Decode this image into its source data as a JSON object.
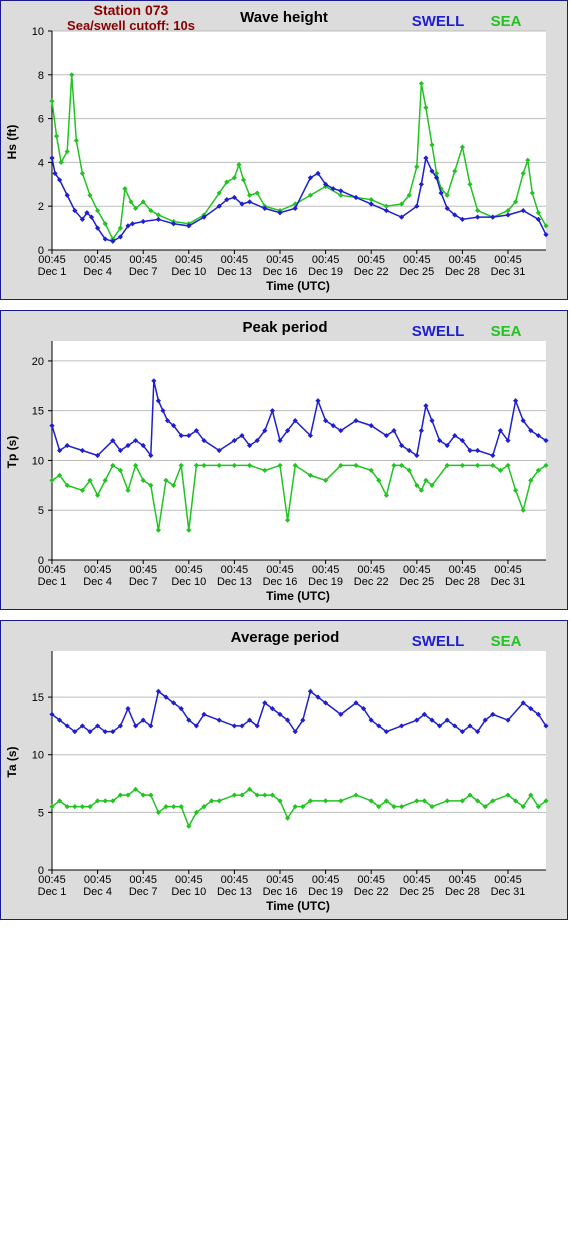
{
  "header": {
    "station": "Station 073",
    "cutoff": "Sea/swell cutoff: 10s"
  },
  "legend": {
    "swell": "SWELL",
    "sea": "SEA"
  },
  "colors": {
    "swell": "#1f1fd0",
    "sea": "#22c322",
    "panel_bg": "#dcdcdc",
    "border": "#1a1a8c",
    "header": "#8b0000"
  },
  "x_axis": {
    "label": "Time (UTC)",
    "tick_time": "00:45",
    "tick_dates": [
      "Dec 1",
      "Dec 4",
      "Dec 7",
      "Dec 10",
      "Dec 13",
      "Dec 16",
      "Dec 19",
      "Dec 22",
      "Dec 25",
      "Dec 28",
      "Dec 31"
    ]
  },
  "chart_data": [
    {
      "type": "line",
      "title": "Wave height",
      "ylabel": "Hs (ft)",
      "ylim": [
        0,
        10
      ],
      "yticks": [
        0,
        2,
        4,
        6,
        8,
        10
      ],
      "xlim": [
        1,
        33.5
      ],
      "series": [
        {
          "name": "SWELL",
          "color": "#1f1fd0",
          "x": [
            1.0,
            1.2,
            1.5,
            2.0,
            2.5,
            3.0,
            3.3,
            3.6,
            4.0,
            4.5,
            5.0,
            5.5,
            6.0,
            6.3,
            7.0,
            8.0,
            9.0,
            10.0,
            11.0,
            12.0,
            12.5,
            13.0,
            13.5,
            14.0,
            15.0,
            16.0,
            17.0,
            18.0,
            18.5,
            19.0,
            19.5,
            20.0,
            21.0,
            22.0,
            23.0,
            24.0,
            25.0,
            25.3,
            25.6,
            26.0,
            26.3,
            26.6,
            27.0,
            27.5,
            28.0,
            29.0,
            30.0,
            31.0,
            32.0,
            33.0,
            33.5
          ],
          "y": [
            4.2,
            3.5,
            3.2,
            2.5,
            1.8,
            1.4,
            1.7,
            1.5,
            1.0,
            0.5,
            0.4,
            0.6,
            1.1,
            1.2,
            1.3,
            1.4,
            1.2,
            1.1,
            1.5,
            2.0,
            2.3,
            2.4,
            2.1,
            2.2,
            1.9,
            1.7,
            1.9,
            3.3,
            3.5,
            3.0,
            2.8,
            2.7,
            2.4,
            2.1,
            1.8,
            1.5,
            2.0,
            3.0,
            4.2,
            3.6,
            3.3,
            2.6,
            1.9,
            1.6,
            1.4,
            1.5,
            1.5,
            1.6,
            1.8,
            1.4,
            0.7
          ]
        },
        {
          "name": "SEA",
          "color": "#22c322",
          "x": [
            1.0,
            1.3,
            1.6,
            2.0,
            2.3,
            2.6,
            3.0,
            3.5,
            4.0,
            4.5,
            5.0,
            5.5,
            5.8,
            6.2,
            6.5,
            7.0,
            7.5,
            8.0,
            9.0,
            10.0,
            11.0,
            12.0,
            12.5,
            13.0,
            13.3,
            13.6,
            14.0,
            14.5,
            15.0,
            16.0,
            17.0,
            18.0,
            19.0,
            20.0,
            21.0,
            22.0,
            23.0,
            24.0,
            24.5,
            25.0,
            25.3,
            25.6,
            26.0,
            26.3,
            26.6,
            27.0,
            27.5,
            28.0,
            28.5,
            29.0,
            30.0,
            31.0,
            31.5,
            32.0,
            32.3,
            32.6,
            33.0,
            33.5
          ],
          "y": [
            6.8,
            5.2,
            4.0,
            4.5,
            8.0,
            5.0,
            3.5,
            2.5,
            1.8,
            1.2,
            0.5,
            1.0,
            2.8,
            2.2,
            1.9,
            2.2,
            1.8,
            1.6,
            1.3,
            1.2,
            1.6,
            2.6,
            3.1,
            3.3,
            3.9,
            3.2,
            2.5,
            2.6,
            2.0,
            1.8,
            2.1,
            2.5,
            2.9,
            2.5,
            2.4,
            2.3,
            2.0,
            2.1,
            2.5,
            3.8,
            7.6,
            6.5,
            4.8,
            3.5,
            2.8,
            2.5,
            3.6,
            4.7,
            3.0,
            1.8,
            1.5,
            1.8,
            2.2,
            3.5,
            4.1,
            2.6,
            1.7,
            1.1
          ]
        }
      ]
    },
    {
      "type": "line",
      "title": "Peak period",
      "ylabel": "Tp (s)",
      "ylim": [
        0,
        22
      ],
      "yticks": [
        0,
        5,
        10,
        15,
        20
      ],
      "xlim": [
        1,
        33.5
      ],
      "series": [
        {
          "name": "SWELL",
          "color": "#1f1fd0",
          "x": [
            1.0,
            1.5,
            2.0,
            3.0,
            4.0,
            5.0,
            5.5,
            6.0,
            6.5,
            7.0,
            7.5,
            7.7,
            8.0,
            8.3,
            8.6,
            9.0,
            9.5,
            10.0,
            10.5,
            11.0,
            12.0,
            13.0,
            13.5,
            14.0,
            14.5,
            15.0,
            15.5,
            16.0,
            16.5,
            17.0,
            18.0,
            18.5,
            19.0,
            19.5,
            20.0,
            21.0,
            22.0,
            23.0,
            23.5,
            24.0,
            24.5,
            25.0,
            25.3,
            25.6,
            26.0,
            26.5,
            27.0,
            27.5,
            28.0,
            28.5,
            29.0,
            30.0,
            30.5,
            31.0,
            31.5,
            32.0,
            32.5,
            33.0,
            33.5
          ],
          "y": [
            13.5,
            11.0,
            11.5,
            11.0,
            10.5,
            12.0,
            11.0,
            11.5,
            12.0,
            11.5,
            10.5,
            18.0,
            16.0,
            15.0,
            14.0,
            13.5,
            12.5,
            12.5,
            13.0,
            12.0,
            11.0,
            12.0,
            12.5,
            11.5,
            12.0,
            13.0,
            15.0,
            12.0,
            13.0,
            14.0,
            12.5,
            16.0,
            14.0,
            13.5,
            13.0,
            14.0,
            13.5,
            12.5,
            13.0,
            11.5,
            11.0,
            10.5,
            13.0,
            15.5,
            14.0,
            12.0,
            11.5,
            12.5,
            12.0,
            11.0,
            11.0,
            10.5,
            13.0,
            12.0,
            16.0,
            14.0,
            13.0,
            12.5,
            12.0
          ]
        },
        {
          "name": "SEA",
          "color": "#22c322",
          "x": [
            1.0,
            1.5,
            2.0,
            3.0,
            3.5,
            4.0,
            4.5,
            5.0,
            5.5,
            6.0,
            6.5,
            7.0,
            7.5,
            8.0,
            8.5,
            9.0,
            9.5,
            10.0,
            10.5,
            11.0,
            12.0,
            13.0,
            14.0,
            15.0,
            16.0,
            16.5,
            17.0,
            18.0,
            19.0,
            20.0,
            21.0,
            22.0,
            22.5,
            23.0,
            23.5,
            24.0,
            24.5,
            25.0,
            25.3,
            25.6,
            26.0,
            27.0,
            28.0,
            29.0,
            30.0,
            30.5,
            31.0,
            31.5,
            32.0,
            32.5,
            33.0,
            33.5
          ],
          "y": [
            8.0,
            8.5,
            7.5,
            7.0,
            8.0,
            6.5,
            8.0,
            9.5,
            9.0,
            7.0,
            9.5,
            8.0,
            7.5,
            3.0,
            8.0,
            7.5,
            9.5,
            3.0,
            9.5,
            9.5,
            9.5,
            9.5,
            9.5,
            9.0,
            9.5,
            4.0,
            9.5,
            8.5,
            8.0,
            9.5,
            9.5,
            9.0,
            8.0,
            6.5,
            9.5,
            9.5,
            9.0,
            7.5,
            7.0,
            8.0,
            7.5,
            9.5,
            9.5,
            9.5,
            9.5,
            9.0,
            9.5,
            7.0,
            5.0,
            8.0,
            9.0,
            9.5
          ]
        }
      ]
    },
    {
      "type": "line",
      "title": "Average period",
      "ylabel": "Ta (s)",
      "ylim": [
        0,
        19
      ],
      "yticks": [
        0,
        5,
        10,
        15
      ],
      "xlim": [
        1,
        33.5
      ],
      "series": [
        {
          "name": "SWELL",
          "color": "#1f1fd0",
          "x": [
            1.0,
            1.5,
            2.0,
            2.5,
            3.0,
            3.5,
            4.0,
            4.5,
            5.0,
            5.5,
            6.0,
            6.5,
            7.0,
            7.5,
            8.0,
            8.5,
            9.0,
            9.5,
            10.0,
            10.5,
            11.0,
            12.0,
            13.0,
            13.5,
            14.0,
            14.5,
            15.0,
            15.5,
            16.0,
            16.5,
            17.0,
            17.5,
            18.0,
            18.5,
            19.0,
            20.0,
            21.0,
            21.5,
            22.0,
            22.5,
            23.0,
            24.0,
            25.0,
            25.5,
            26.0,
            26.5,
            27.0,
            27.5,
            28.0,
            28.5,
            29.0,
            29.5,
            30.0,
            31.0,
            32.0,
            32.5,
            33.0,
            33.5
          ],
          "y": [
            13.5,
            13.0,
            12.5,
            12.0,
            12.5,
            12.0,
            12.5,
            12.0,
            12.0,
            12.5,
            14.0,
            12.5,
            13.0,
            12.5,
            15.5,
            15.0,
            14.5,
            14.0,
            13.0,
            12.5,
            13.5,
            13.0,
            12.5,
            12.5,
            13.0,
            12.5,
            14.5,
            14.0,
            13.5,
            13.0,
            12.0,
            13.0,
            15.5,
            15.0,
            14.5,
            13.5,
            14.5,
            14.0,
            13.0,
            12.5,
            12.0,
            12.5,
            13.0,
            13.5,
            13.0,
            12.5,
            13.0,
            12.5,
            12.0,
            12.5,
            12.0,
            13.0,
            13.5,
            13.0,
            14.5,
            14.0,
            13.5,
            12.5
          ]
        },
        {
          "name": "SEA",
          "color": "#22c322",
          "x": [
            1.0,
            1.5,
            2.0,
            2.5,
            3.0,
            3.5,
            4.0,
            4.5,
            5.0,
            5.5,
            6.0,
            6.5,
            7.0,
            7.5,
            8.0,
            8.5,
            9.0,
            9.5,
            10.0,
            10.5,
            11.0,
            11.5,
            12.0,
            13.0,
            13.5,
            14.0,
            14.5,
            15.0,
            15.5,
            16.0,
            16.5,
            17.0,
            17.5,
            18.0,
            19.0,
            20.0,
            21.0,
            22.0,
            22.5,
            23.0,
            23.5,
            24.0,
            25.0,
            25.5,
            26.0,
            27.0,
            28.0,
            28.5,
            29.0,
            29.5,
            30.0,
            31.0,
            31.5,
            32.0,
            32.5,
            33.0,
            33.5
          ],
          "y": [
            5.5,
            6.0,
            5.5,
            5.5,
            5.5,
            5.5,
            6.0,
            6.0,
            6.0,
            6.5,
            6.5,
            7.0,
            6.5,
            6.5,
            5.0,
            5.5,
            5.5,
            5.5,
            3.8,
            5.0,
            5.5,
            6.0,
            6.0,
            6.5,
            6.5,
            7.0,
            6.5,
            6.5,
            6.5,
            6.0,
            4.5,
            5.5,
            5.5,
            6.0,
            6.0,
            6.0,
            6.5,
            6.0,
            5.5,
            6.0,
            5.5,
            5.5,
            6.0,
            6.0,
            5.5,
            6.0,
            6.0,
            6.5,
            6.0,
            5.5,
            6.0,
            6.5,
            6.0,
            5.5,
            6.5,
            5.5,
            6.0
          ]
        }
      ]
    }
  ]
}
